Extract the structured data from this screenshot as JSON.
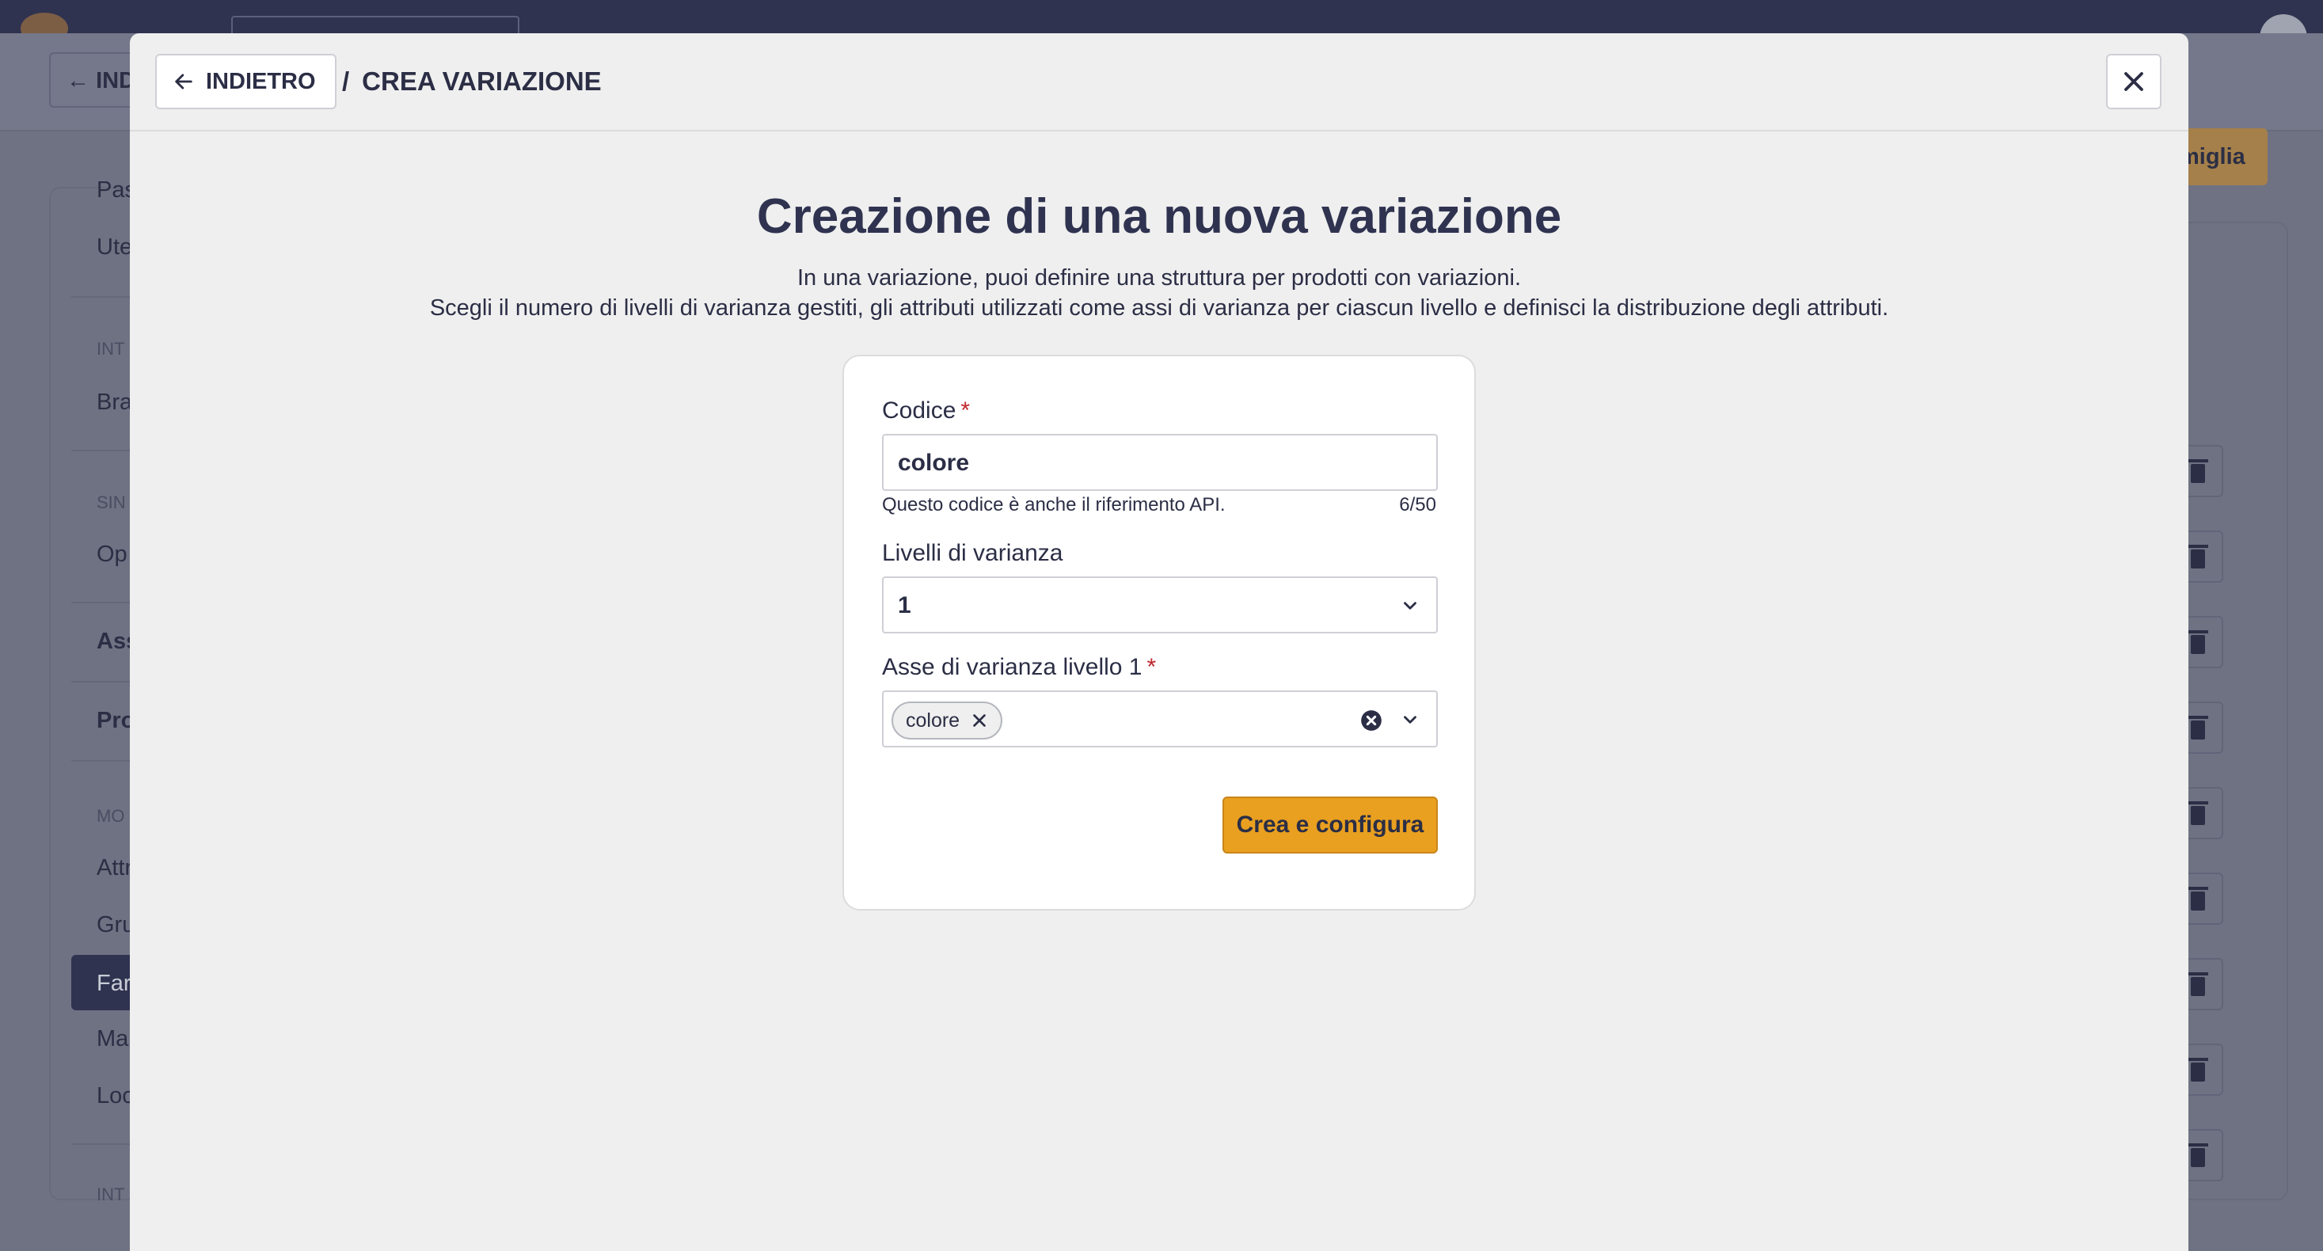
{
  "background": {
    "back_label": "IND",
    "orange_button_label": "miglia",
    "sidebar": {
      "items": [
        "Pas",
        "Ute",
        "Bra",
        "Op",
        "Ass",
        "Pro",
        "Attr",
        "Gru",
        "Far",
        "Ma",
        "Loc"
      ],
      "sections": [
        "INT",
        "SIN",
        "MO",
        "INT"
      ]
    }
  },
  "modal": {
    "back_label": "INDIETRO",
    "breadcrumb_sep": "/",
    "breadcrumb_current": "CREA VARIAZIONE",
    "title": "Creazione di una nuova variazione",
    "subtitle_line1": "In una variazione, puoi definire una struttura per prodotti con variazioni.",
    "subtitle_line2": "Scegli il numero di livelli di varianza gestiti, gli attributi utilizzati come assi di varianza per ciascun livello e definisci la distribuzione degli attributi.",
    "form": {
      "code_label": "Codice",
      "required_mark": "*",
      "code_value": "colore",
      "code_helper": "Questo codice è anche il riferimento API.",
      "code_counter": "6/50",
      "levels_label": "Livelli di varianza",
      "levels_value": "1",
      "axis_label": "Asse di varianza livello 1",
      "axis_chip": "colore",
      "submit_label": "Crea e configura"
    }
  }
}
